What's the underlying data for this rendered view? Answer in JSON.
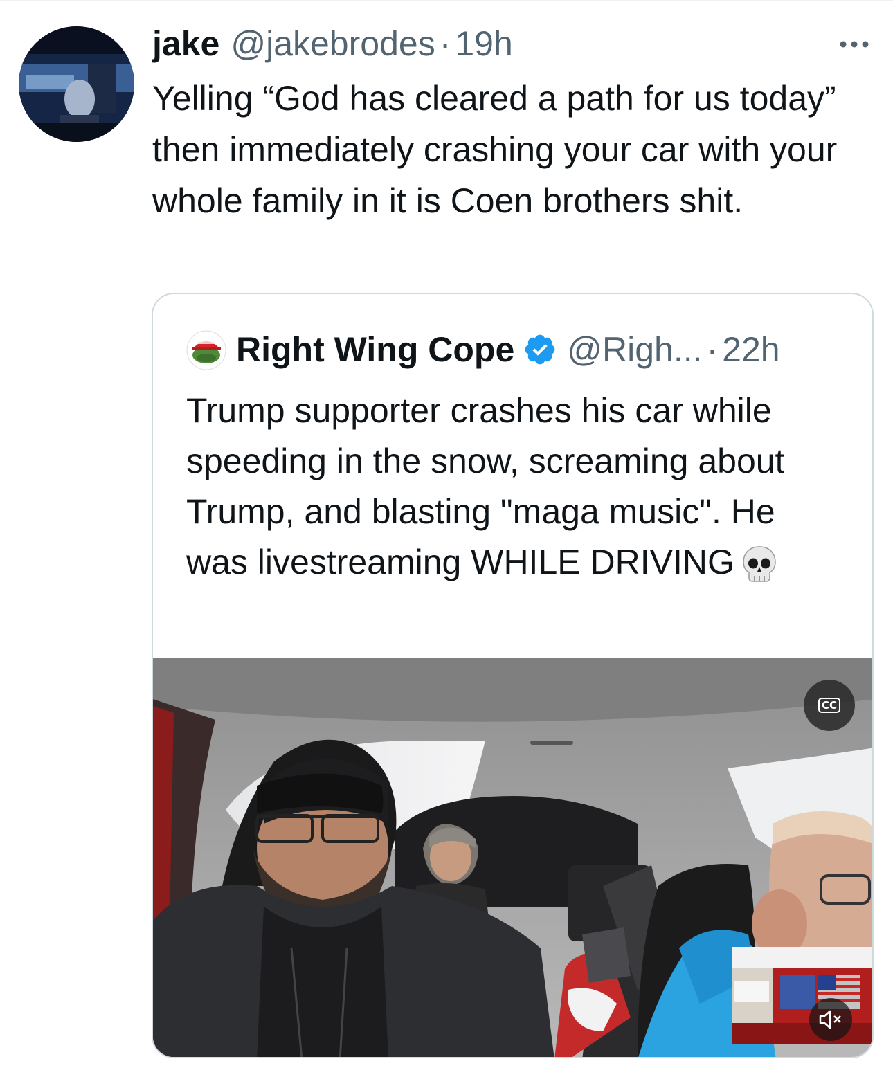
{
  "tweet": {
    "author_name": "jake",
    "author_handle": "@jakebrodes",
    "separator": "·",
    "time": "19h",
    "text": "Yelling “God has cleared a path for us today” then immediately crashing your car with your whole family in it is Coen brothers shit.",
    "more_icon": "more-horizontal-icon"
  },
  "quote": {
    "author_name": "Right Wing Cope",
    "verified_icon": "verified-badge-icon",
    "author_handle": "@Righ...",
    "separator": "·",
    "time": "22h",
    "text": "Trump supporter crashes his car while speeding in the snow, screaming about Trump, and blasting \"maga music\". He was livestreaming WHILE DRIVING",
    "emoji_icon": "skull-icon",
    "media": {
      "type": "video",
      "cc_label": "CC",
      "mute_icon": "muted-speaker-icon"
    }
  },
  "colors": {
    "text_primary": "#0f1419",
    "text_secondary": "#536471",
    "border": "#cfd9de",
    "verified_blue": "#1d9bf0"
  }
}
